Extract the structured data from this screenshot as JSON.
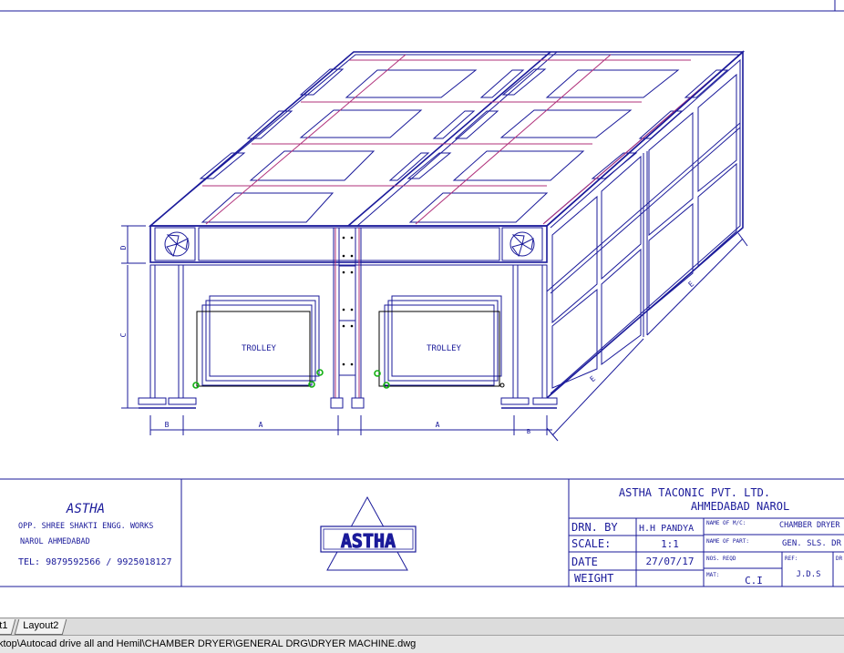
{
  "drawing": {
    "dim_a": "A",
    "dim_b": "B",
    "dim_c": "C",
    "dim_d": "D",
    "dim_e": "E",
    "trolley_label": "TROLLEY"
  },
  "company_block": {
    "name": "ASTHA",
    "address_line1": "OPP. SHREE SHAKTI ENGG. WORKS",
    "address_line2": "NAROL AHMEDABAD",
    "phone": "TEL: 9879592566 / 9925018127"
  },
  "logo": {
    "text": "ASTHA"
  },
  "title_block": {
    "company": "ASTHA TACONIC PVT. LTD.",
    "location": "AHMEDABAD NAROL",
    "drn_by_label": "DRN. BY",
    "drn_by_value": "H.H PANDYA",
    "scale_label": "SCALE:",
    "scale_value": "1:1",
    "date_label": "DATE",
    "date_value": "27/07/17",
    "weight_label": "WEIGHT",
    "name_of_mc_label": "NAME OF M/C:",
    "name_of_mc_value": "CHAMBER DRYER",
    "name_of_part_label": "NAME OF PART:",
    "name_of_part_value": "GEN. SLS. DR",
    "nos_reqd_label": "NOS. REQD",
    "mat_label": "MAT:",
    "mat_value": "C.I",
    "ref_label": "REF:",
    "ref_value": "J.D.S",
    "dr_label": "DR"
  },
  "tabs": [
    {
      "label": "t1"
    },
    {
      "label": "Layout2"
    }
  ],
  "status_bar": {
    "path": "ktop\\Autocad drive all and  Hemil\\CHAMBER DRYER\\GENERAL DRG\\DRYER MACHINE.dwg"
  },
  "colors": {
    "line": "#1a1a9a",
    "accent": "#b0307a",
    "marker": "#12b012"
  }
}
